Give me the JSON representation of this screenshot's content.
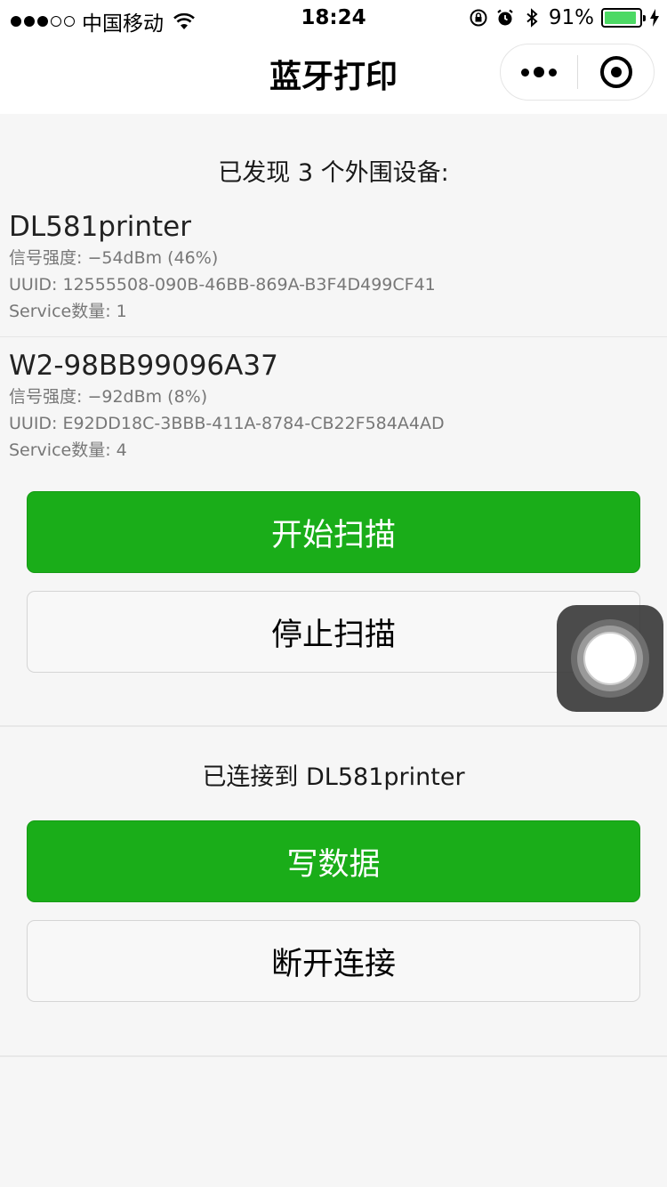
{
  "status_bar": {
    "carrier": "中国移动",
    "time": "18:24",
    "battery": "91%",
    "battery_level": 0.91
  },
  "nav": {
    "title": "蓝牙打印"
  },
  "discovery": {
    "heading": "已发现 3 个外围设备:",
    "devices": [
      {
        "name": "DL581printer",
        "signal": "信号强度: −54dBm (46%)",
        "uuid": "UUID: 12555508-090B-46BB-869A-B3F4D499CF41",
        "services": "Service数量: 1"
      },
      {
        "name": "W2-98BB99096A37",
        "signal": "信号强度: −92dBm (8%)",
        "uuid": "UUID: E92DD18C-3BBB-411A-8784-CB22F584A4AD",
        "services": "Service数量: 4"
      }
    ]
  },
  "scan": {
    "start_label": "开始扫描",
    "stop_label": "停止扫描"
  },
  "connection": {
    "status": "已连接到 DL581printer",
    "write_label": "写数据",
    "disconnect_label": "断开连接"
  }
}
